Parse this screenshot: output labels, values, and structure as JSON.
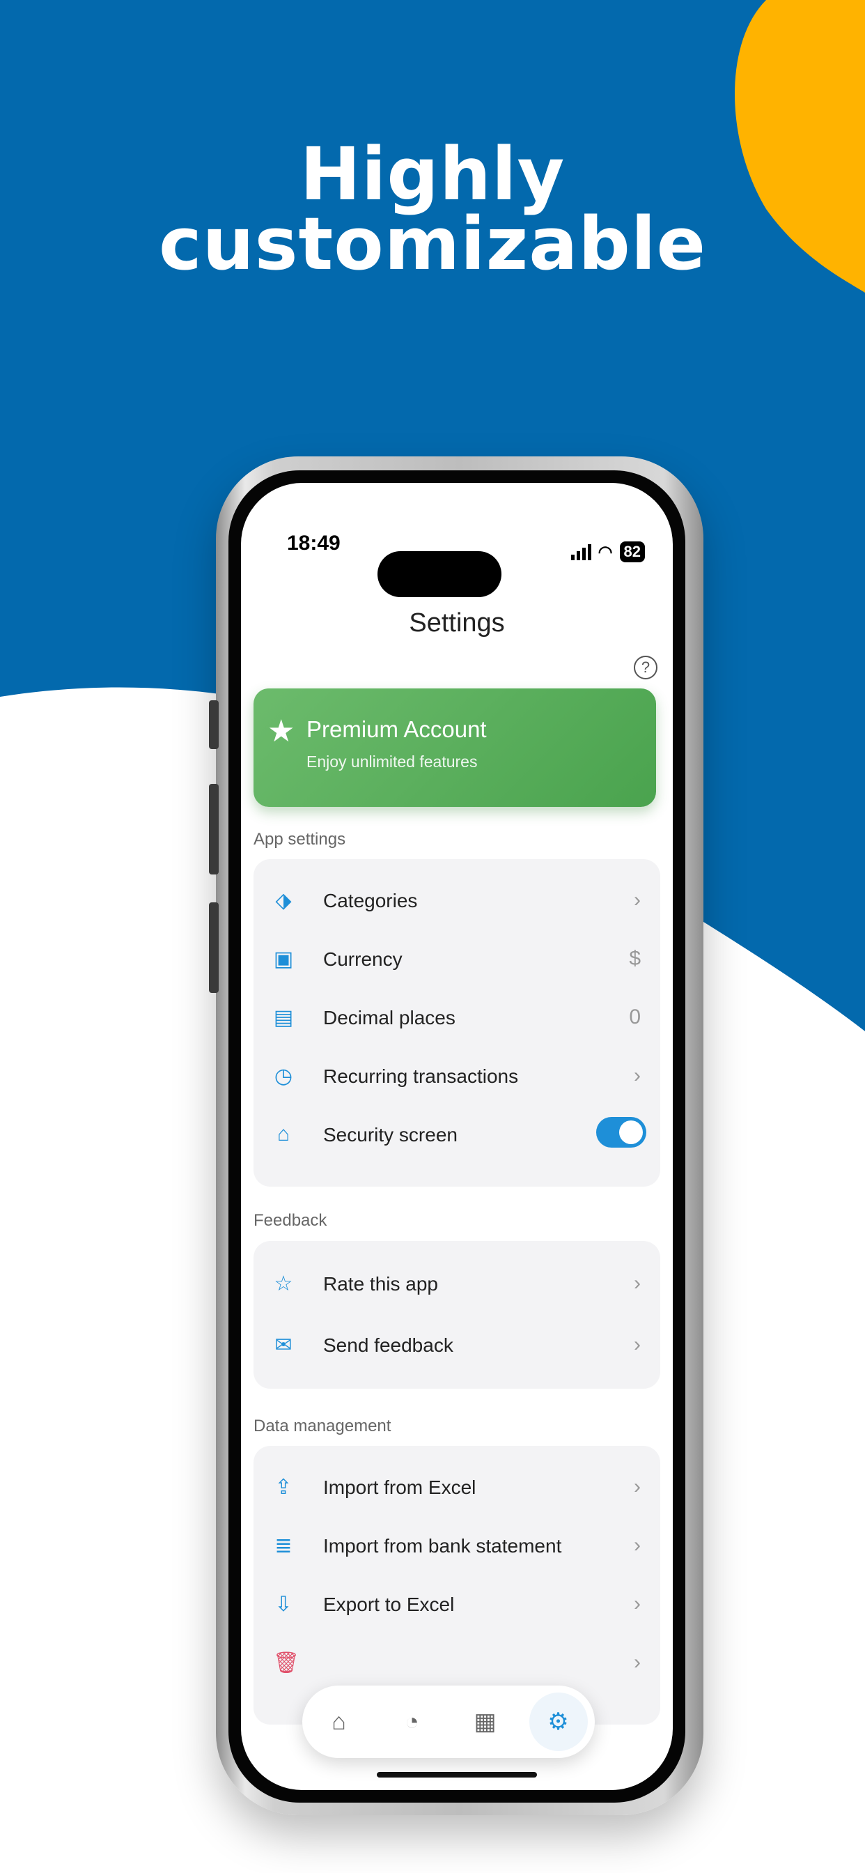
{
  "colors": {
    "blue_bg": "#0369ad",
    "accent_yellow": "#ffb300",
    "premium_green": "#57ad57",
    "link_blue": "#1e8fd8"
  },
  "headline": {
    "line1": "Highly",
    "line2": "customizable"
  },
  "status_bar": {
    "time": "18:49",
    "battery": "82"
  },
  "screen": {
    "title": "Settings",
    "help_icon": "?",
    "premium": {
      "icon": "★",
      "title": "Premium Account",
      "subtitle": "Enjoy unlimited features"
    },
    "app_settings": {
      "label": "App settings",
      "items": [
        {
          "icon": "tag-icon",
          "glyph": "⬗",
          "label": "Categories",
          "trailing": "›"
        },
        {
          "icon": "currency-icon",
          "glyph": "▣",
          "label": "Currency",
          "trailing": "$"
        },
        {
          "icon": "calculator-icon",
          "glyph": "▤",
          "label": "Decimal places",
          "trailing": "0"
        },
        {
          "icon": "clock-icon",
          "glyph": "◷",
          "label": "Recurring transactions",
          "trailing": "›"
        },
        {
          "icon": "lock-icon",
          "glyph": "⌂",
          "label": "Security screen",
          "trailing": "toggle-on"
        }
      ]
    },
    "feedback": {
      "label": "Feedback",
      "items": [
        {
          "icon": "star-outline-icon",
          "glyph": "☆",
          "label": "Rate this app",
          "trailing": "›"
        },
        {
          "icon": "chat-icon",
          "glyph": "✉",
          "label": "Send feedback",
          "trailing": "›"
        }
      ]
    },
    "data_management": {
      "label": "Data management",
      "items": [
        {
          "icon": "file-upload-icon",
          "glyph": "⇪",
          "label": "Import from Excel",
          "trailing": "›"
        },
        {
          "icon": "file-text-icon",
          "glyph": "≣",
          "label": "Import from bank statement",
          "trailing": "›"
        },
        {
          "icon": "file-download-icon",
          "glyph": "⇩",
          "label": "Export to Excel",
          "trailing": "›"
        },
        {
          "icon": "trash-icon",
          "glyph": "🗑",
          "label": "",
          "trailing": "›"
        }
      ]
    },
    "tabbar": [
      {
        "icon": "bank-icon",
        "glyph": "⌂",
        "active": false
      },
      {
        "icon": "pie-chart-icon",
        "glyph": "◔",
        "active": false
      },
      {
        "icon": "table-icon",
        "glyph": "▦",
        "active": false
      },
      {
        "icon": "gear-icon",
        "glyph": "⚙",
        "active": true
      }
    ]
  }
}
